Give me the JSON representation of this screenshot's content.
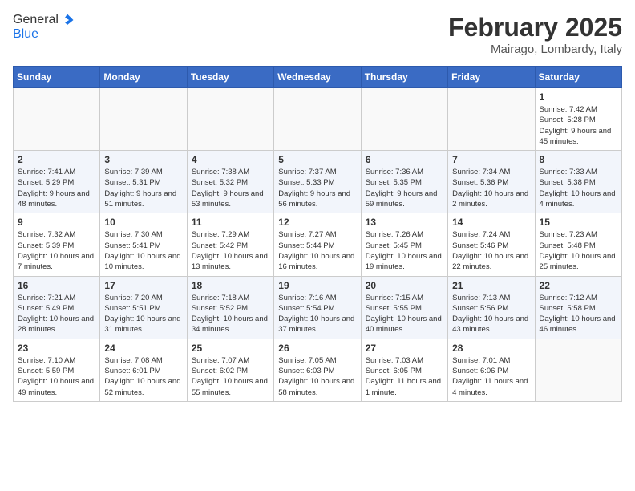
{
  "header": {
    "logo_line1": "General",
    "logo_line2": "Blue",
    "month_title": "February 2025",
    "location": "Mairago, Lombardy, Italy"
  },
  "weekdays": [
    "Sunday",
    "Monday",
    "Tuesday",
    "Wednesday",
    "Thursday",
    "Friday",
    "Saturday"
  ],
  "weeks": [
    [
      {
        "day": "",
        "info": ""
      },
      {
        "day": "",
        "info": ""
      },
      {
        "day": "",
        "info": ""
      },
      {
        "day": "",
        "info": ""
      },
      {
        "day": "",
        "info": ""
      },
      {
        "day": "",
        "info": ""
      },
      {
        "day": "1",
        "info": "Sunrise: 7:42 AM\nSunset: 5:28 PM\nDaylight: 9 hours and 45 minutes."
      }
    ],
    [
      {
        "day": "2",
        "info": "Sunrise: 7:41 AM\nSunset: 5:29 PM\nDaylight: 9 hours and 48 minutes."
      },
      {
        "day": "3",
        "info": "Sunrise: 7:39 AM\nSunset: 5:31 PM\nDaylight: 9 hours and 51 minutes."
      },
      {
        "day": "4",
        "info": "Sunrise: 7:38 AM\nSunset: 5:32 PM\nDaylight: 9 hours and 53 minutes."
      },
      {
        "day": "5",
        "info": "Sunrise: 7:37 AM\nSunset: 5:33 PM\nDaylight: 9 hours and 56 minutes."
      },
      {
        "day": "6",
        "info": "Sunrise: 7:36 AM\nSunset: 5:35 PM\nDaylight: 9 hours and 59 minutes."
      },
      {
        "day": "7",
        "info": "Sunrise: 7:34 AM\nSunset: 5:36 PM\nDaylight: 10 hours and 2 minutes."
      },
      {
        "day": "8",
        "info": "Sunrise: 7:33 AM\nSunset: 5:38 PM\nDaylight: 10 hours and 4 minutes."
      }
    ],
    [
      {
        "day": "9",
        "info": "Sunrise: 7:32 AM\nSunset: 5:39 PM\nDaylight: 10 hours and 7 minutes."
      },
      {
        "day": "10",
        "info": "Sunrise: 7:30 AM\nSunset: 5:41 PM\nDaylight: 10 hours and 10 minutes."
      },
      {
        "day": "11",
        "info": "Sunrise: 7:29 AM\nSunset: 5:42 PM\nDaylight: 10 hours and 13 minutes."
      },
      {
        "day": "12",
        "info": "Sunrise: 7:27 AM\nSunset: 5:44 PM\nDaylight: 10 hours and 16 minutes."
      },
      {
        "day": "13",
        "info": "Sunrise: 7:26 AM\nSunset: 5:45 PM\nDaylight: 10 hours and 19 minutes."
      },
      {
        "day": "14",
        "info": "Sunrise: 7:24 AM\nSunset: 5:46 PM\nDaylight: 10 hours and 22 minutes."
      },
      {
        "day": "15",
        "info": "Sunrise: 7:23 AM\nSunset: 5:48 PM\nDaylight: 10 hours and 25 minutes."
      }
    ],
    [
      {
        "day": "16",
        "info": "Sunrise: 7:21 AM\nSunset: 5:49 PM\nDaylight: 10 hours and 28 minutes."
      },
      {
        "day": "17",
        "info": "Sunrise: 7:20 AM\nSunset: 5:51 PM\nDaylight: 10 hours and 31 minutes."
      },
      {
        "day": "18",
        "info": "Sunrise: 7:18 AM\nSunset: 5:52 PM\nDaylight: 10 hours and 34 minutes."
      },
      {
        "day": "19",
        "info": "Sunrise: 7:16 AM\nSunset: 5:54 PM\nDaylight: 10 hours and 37 minutes."
      },
      {
        "day": "20",
        "info": "Sunrise: 7:15 AM\nSunset: 5:55 PM\nDaylight: 10 hours and 40 minutes."
      },
      {
        "day": "21",
        "info": "Sunrise: 7:13 AM\nSunset: 5:56 PM\nDaylight: 10 hours and 43 minutes."
      },
      {
        "day": "22",
        "info": "Sunrise: 7:12 AM\nSunset: 5:58 PM\nDaylight: 10 hours and 46 minutes."
      }
    ],
    [
      {
        "day": "23",
        "info": "Sunrise: 7:10 AM\nSunset: 5:59 PM\nDaylight: 10 hours and 49 minutes."
      },
      {
        "day": "24",
        "info": "Sunrise: 7:08 AM\nSunset: 6:01 PM\nDaylight: 10 hours and 52 minutes."
      },
      {
        "day": "25",
        "info": "Sunrise: 7:07 AM\nSunset: 6:02 PM\nDaylight: 10 hours and 55 minutes."
      },
      {
        "day": "26",
        "info": "Sunrise: 7:05 AM\nSunset: 6:03 PM\nDaylight: 10 hours and 58 minutes."
      },
      {
        "day": "27",
        "info": "Sunrise: 7:03 AM\nSunset: 6:05 PM\nDaylight: 11 hours and 1 minute."
      },
      {
        "day": "28",
        "info": "Sunrise: 7:01 AM\nSunset: 6:06 PM\nDaylight: 11 hours and 4 minutes."
      },
      {
        "day": "",
        "info": ""
      }
    ]
  ]
}
